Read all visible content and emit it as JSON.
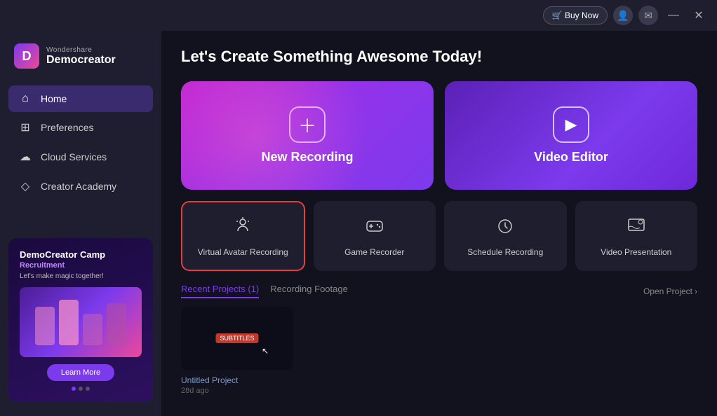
{
  "titleBar": {
    "buyNowLabel": "🛒 Buy Now",
    "minimizeLabel": "—",
    "closeLabel": "✕"
  },
  "logo": {
    "brand": "Wondershare",
    "name": "Democreator"
  },
  "nav": {
    "items": [
      {
        "id": "home",
        "label": "Home",
        "icon": "⌂",
        "active": true
      },
      {
        "id": "preferences",
        "label": "Preferences",
        "icon": "⊞"
      },
      {
        "id": "cloud-services",
        "label": "Cloud Services",
        "icon": "☁"
      },
      {
        "id": "creator-academy",
        "label": "Creator Academy",
        "icon": "◇"
      }
    ]
  },
  "sidebar": {
    "banner": {
      "title": "DemoCreator Camp",
      "subtitle": "Recruitment",
      "tagline": "Let's make magic together!",
      "learnMoreLabel": "Learn More"
    },
    "dots": [
      true,
      false,
      false
    ]
  },
  "main": {
    "pageTitle": "Let's Create Something Awesome Today!",
    "topCards": [
      {
        "id": "new-recording",
        "label": "New Recording",
        "icon": "+"
      },
      {
        "id": "video-editor",
        "label": "Video Editor",
        "icon": "▶"
      }
    ],
    "featureCards": [
      {
        "id": "virtual-avatar",
        "label": "Virtual Avatar Recording",
        "icon": "👤",
        "selected": true
      },
      {
        "id": "game-recorder",
        "label": "Game Recorder",
        "icon": "🎮",
        "selected": false
      },
      {
        "id": "schedule-recording",
        "label": "Schedule Recording",
        "icon": "⏰",
        "selected": false
      },
      {
        "id": "video-presentation",
        "label": "Video Presentation",
        "icon": "👤",
        "selected": false
      }
    ],
    "recentSection": {
      "tabs": [
        {
          "label": "Recent Projects (1)",
          "active": true
        },
        {
          "label": "Recording Footage",
          "active": false
        }
      ],
      "openProjectLabel": "Open Project",
      "projects": [
        {
          "id": "untitled-project",
          "name": "Untitled Project",
          "age": "28d ago",
          "thumbnailLabel": "SUBTITLES"
        }
      ]
    }
  },
  "colors": {
    "accent": "#7c3aed",
    "recordingGradientStart": "#c026d3",
    "recordingGradientEnd": "#7c3aed",
    "editorGradient": "#5b21b6",
    "selectedBorder": "#e53e3e"
  }
}
